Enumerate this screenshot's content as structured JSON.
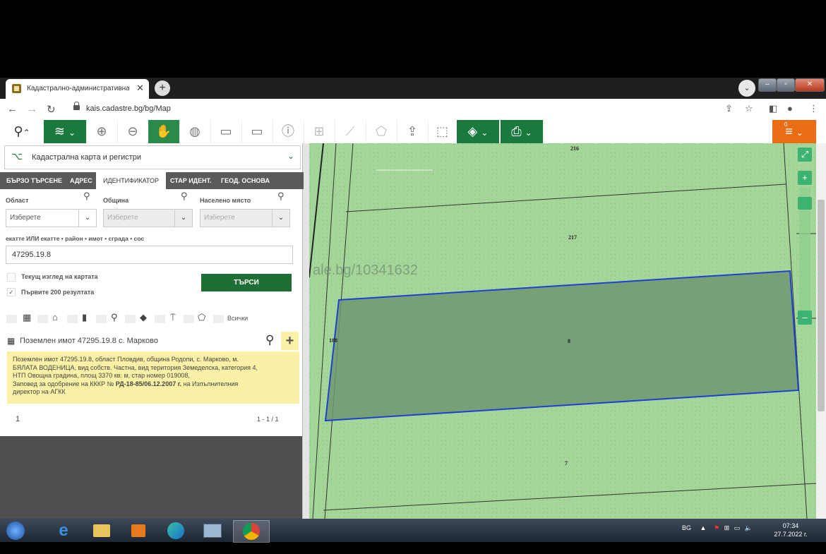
{
  "browser": {
    "tab_title": "Кадастрално-административна",
    "tab_close": "✕",
    "new_tab": "+",
    "url": "kais.cadastre.bg/bg/Map"
  },
  "toolbar": {
    "layers_caret": "⌄",
    "orange_badge": "0"
  },
  "layer_select": {
    "label": "Кадастрална карта и регистри"
  },
  "search_tabs": [
    {
      "label": "БЪРЗО ТЪРСЕНЕ"
    },
    {
      "label": "АДРЕС"
    },
    {
      "label": "ИДЕНТИФИКАТОР",
      "active": true
    },
    {
      "label": "СТАР ИДЕНТ."
    },
    {
      "label": "ГЕОД. ОСНОВА"
    }
  ],
  "form": {
    "oblast_label": "Област",
    "oblast_value": "Изберете",
    "obshtina_label": "Община",
    "obshtina_value": "Изберете",
    "naseleno_label": "Населено място",
    "naseleno_value": "Изберете",
    "id_hint": "екатте ИЛИ екатте • район • имот • сграда • сос",
    "id_value": "47295.19.8",
    "current_view_label": "Текущ изглед на картата",
    "first200_label": "Първите 200 резултата",
    "first200_checked": true,
    "search_button": "ТЪРСИ"
  },
  "filters": {
    "all_label": "Всички"
  },
  "result": {
    "title": "Поземлен имот 47295.19.8 с. Марково",
    "line1": "Поземлен имот 47295.19.8, област Пловдив, община Родопи, с. Марково, м.",
    "line2": "БЯЛАТА ВОДЕНИЦА, вид собств. Частна, вид територия Земеделска, категория 4,",
    "line3": "НТП Овощна градина, площ 3370 кв. м, стар номер 019008,",
    "line4_pre": "Заповед за одобрение на КККР № ",
    "line4_bold": "РД-18-85/06.12.2007 г.",
    "line4_post": " на Изпълнителния",
    "line5": "директор на АГКК",
    "page": "1",
    "range": "1 - 1 / 1"
  },
  "map": {
    "parcel_labels": [
      "216",
      "217",
      "8",
      "188",
      "7"
    ],
    "watermark": "ale.bg/10341632",
    "fill_color": "#a4d69a",
    "highlight_stroke": "#1f3fd1"
  },
  "taskbar": {
    "lang": "BG",
    "time": "07:34",
    "date": "27.7.2022 г."
  }
}
